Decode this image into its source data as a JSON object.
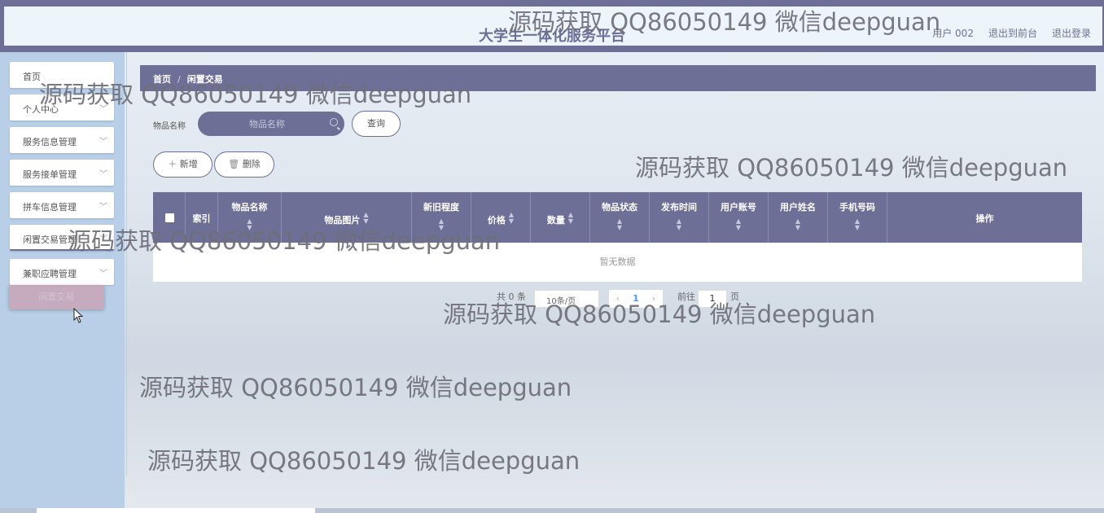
{
  "header": {
    "title": "大学生一体化服务平台",
    "user": "用户 002",
    "links": [
      "退出到前台",
      "退出登录"
    ]
  },
  "sidebar": {
    "items": [
      {
        "label": "首页",
        "has_chevron": false
      },
      {
        "label": "个人中心",
        "has_chevron": true
      },
      {
        "label": "服务信息管理",
        "has_chevron": true
      },
      {
        "label": "服务接单管理",
        "has_chevron": true
      },
      {
        "label": "拼车信息管理",
        "has_chevron": true
      },
      {
        "label": "闲置交易管理",
        "has_chevron": true
      },
      {
        "label": "兼职应聘管理",
        "has_chevron": true
      }
    ],
    "ghost_label": "闲置交易"
  },
  "breadcrumb": {
    "home": "首页",
    "separator": "/",
    "current": "闲置交易"
  },
  "search": {
    "label": "物品名称",
    "placeholder": "物品名称",
    "button": "查询"
  },
  "actions": {
    "add": "新增",
    "delete": "删除"
  },
  "table": {
    "columns": [
      "索引",
      "物品名称",
      "物品图片",
      "新旧程度",
      "价格",
      "数量",
      "物品状态",
      "发布时间",
      "用户账号",
      "用户姓名",
      "手机号码",
      "操作"
    ],
    "empty_text": "暂无数据"
  },
  "pagination": {
    "total": "共 0 条",
    "page_size": "10条/页",
    "current_page": "1",
    "goto_label": "前往",
    "goto_value": "1",
    "page_suffix": "页"
  },
  "watermark": "源码获取 QQ86050149 微信deepguan",
  "colors": {
    "primary": "#6e6f96",
    "sidebar": "#b8cfe7",
    "link_active": "#409eff"
  }
}
